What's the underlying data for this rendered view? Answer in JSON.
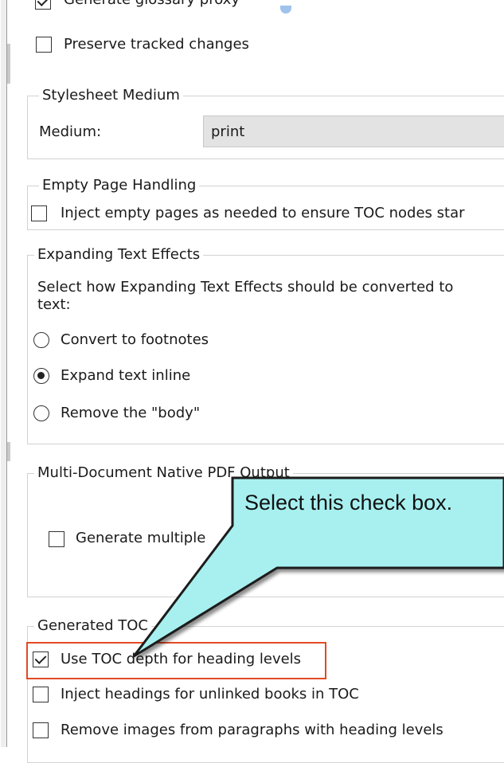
{
  "options_top": {
    "glossary_proxy_label": "Generate glossary proxy",
    "preserve_tracked_label": "Preserve tracked changes",
    "preserve_tracked_checked": false
  },
  "stylesheet_medium": {
    "legend": "Stylesheet Medium",
    "field_label": "Medium:",
    "value": "print"
  },
  "empty_page": {
    "legend": "Empty Page Handling",
    "inject_label": "Inject empty pages as needed to ensure TOC nodes star",
    "inject_checked": false
  },
  "expanding_text": {
    "legend": "Expanding Text Effects",
    "description": "Select how Expanding Text Effects should be converted to",
    "description_cont": "text:",
    "options": [
      {
        "label": "Convert to footnotes",
        "selected": false
      },
      {
        "label": "Expand text inline",
        "selected": true
      },
      {
        "label": "Remove the \"body\"",
        "selected": false
      }
    ]
  },
  "multi_doc": {
    "legend": "Multi-Document Native PDF Output",
    "generate_label": "Generate multiple",
    "generate_checked": false
  },
  "generated_toc": {
    "legend": "Generated TOC",
    "items": [
      {
        "label": "Use TOC depth for heading levels",
        "checked": true
      },
      {
        "label": "Inject headings for unlinked books in TOC",
        "checked": false
      },
      {
        "label": "Remove images from paragraphs with heading levels",
        "checked": false
      }
    ]
  },
  "callout": {
    "text": "Select this check box.",
    "fill_color": "#a8f0f0",
    "border_color": "#1a1a1a"
  },
  "highlight_color": "#e14a24"
}
